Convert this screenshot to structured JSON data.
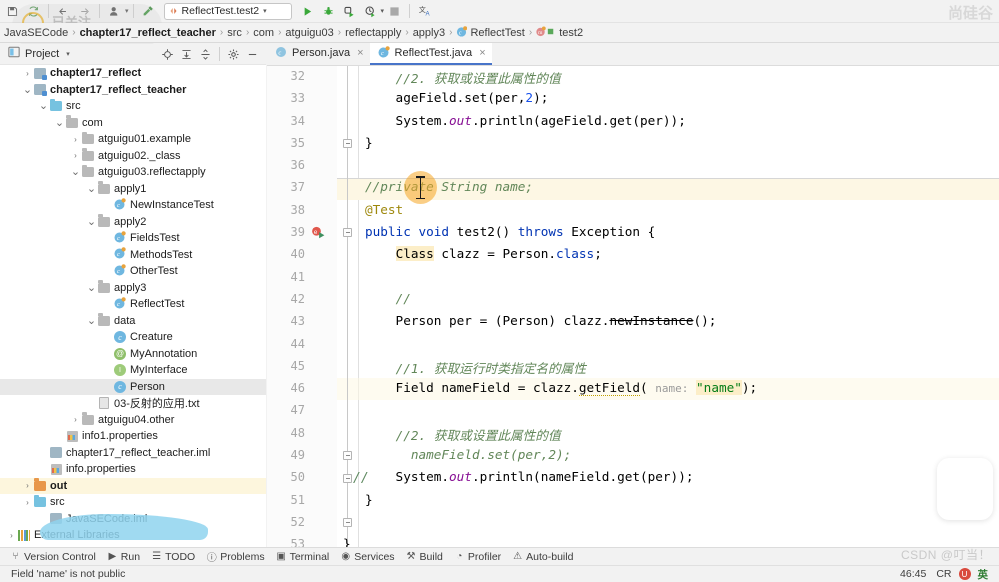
{
  "toolbar": {
    "icons": [
      "save-all-icon",
      "sync-icon",
      "back-arrow-icon",
      "forward-arrow-icon",
      "profile-icon",
      "build-hammer-icon"
    ],
    "run_config": {
      "label": "ReflectTest.test2"
    },
    "actions": [
      "run-icon",
      "debug-icon",
      "run-coverage-icon",
      "profile-run-icon",
      "stop-icon",
      "translate-icon"
    ]
  },
  "breadcrumb": {
    "items": [
      {
        "label": "JavaSECode",
        "bold": false
      },
      {
        "label": "chapter17_reflect_teacher",
        "bold": true
      },
      {
        "label": "src",
        "bold": false
      },
      {
        "label": "com",
        "bold": false
      },
      {
        "label": "atguigu03",
        "bold": false
      },
      {
        "label": "reflectapply",
        "bold": false
      },
      {
        "label": "apply3",
        "bold": false
      },
      {
        "label": "ReflectTest",
        "bold": false
      },
      {
        "label": "test2",
        "bold": false
      }
    ],
    "separator": "›"
  },
  "project_panel": {
    "title": "Project",
    "dropdown_caret": "▾",
    "header_icons": [
      "locate-icon",
      "expand-all-icon",
      "collapse-all-icon",
      "settings-gear-icon",
      "hide-icon"
    ],
    "tree": [
      {
        "label": "chapter17_reflect",
        "indent": 1,
        "twist": "›",
        "icon": "module-icon",
        "bold": true,
        "sel": ""
      },
      {
        "label": "chapter17_reflect_teacher",
        "indent": 1,
        "twist": "⌄",
        "icon": "module-icon",
        "bold": true,
        "sel": ""
      },
      {
        "label": "src",
        "indent": 2,
        "twist": "⌄",
        "icon": "folder-blue",
        "bold": false,
        "sel": ""
      },
      {
        "label": "com",
        "indent": 3,
        "twist": "⌄",
        "icon": "folder-pkg",
        "bold": false,
        "sel": ""
      },
      {
        "label": "atguigu01.example",
        "indent": 4,
        "twist": "›",
        "icon": "folder-pkg",
        "bold": false,
        "sel": ""
      },
      {
        "label": "atguigu02._class",
        "indent": 4,
        "twist": "›",
        "icon": "folder-pkg",
        "bold": false,
        "sel": ""
      },
      {
        "label": "atguigu03.reflectapply",
        "indent": 4,
        "twist": "⌄",
        "icon": "folder-pkg",
        "bold": false,
        "sel": ""
      },
      {
        "label": "apply1",
        "indent": 5,
        "twist": "⌄",
        "icon": "folder-pkg",
        "bold": false,
        "sel": ""
      },
      {
        "label": "NewInstanceTest",
        "indent": 6,
        "twist": "",
        "icon": "class-test",
        "bold": false,
        "sel": ""
      },
      {
        "label": "apply2",
        "indent": 5,
        "twist": "⌄",
        "icon": "folder-pkg",
        "bold": false,
        "sel": ""
      },
      {
        "label": "FieldsTest",
        "indent": 6,
        "twist": "",
        "icon": "class-test",
        "bold": false,
        "sel": ""
      },
      {
        "label": "MethodsTest",
        "indent": 6,
        "twist": "",
        "icon": "class-test",
        "bold": false,
        "sel": ""
      },
      {
        "label": "OtherTest",
        "indent": 6,
        "twist": "",
        "icon": "class-test",
        "bold": false,
        "sel": ""
      },
      {
        "label": "apply3",
        "indent": 5,
        "twist": "⌄",
        "icon": "folder-pkg",
        "bold": false,
        "sel": ""
      },
      {
        "label": "ReflectTest",
        "indent": 6,
        "twist": "",
        "icon": "class-test",
        "bold": false,
        "sel": ""
      },
      {
        "label": "data",
        "indent": 5,
        "twist": "⌄",
        "icon": "folder-pkg",
        "bold": false,
        "sel": ""
      },
      {
        "label": "Creature",
        "indent": 6,
        "twist": "",
        "icon": "class",
        "bold": false,
        "sel": ""
      },
      {
        "label": "MyAnnotation",
        "indent": 6,
        "twist": "",
        "icon": "annotation",
        "bold": false,
        "sel": ""
      },
      {
        "label": "MyInterface",
        "indent": 6,
        "twist": "",
        "icon": "interface",
        "bold": false,
        "sel": ""
      },
      {
        "label": "Person",
        "indent": 6,
        "twist": "",
        "icon": "class",
        "bold": false,
        "sel": "grey"
      },
      {
        "label": "03-反射的应用.txt",
        "indent": 5,
        "twist": "",
        "icon": "txt",
        "bold": false,
        "sel": ""
      },
      {
        "label": "atguigu04.other",
        "indent": 4,
        "twist": "›",
        "icon": "folder-pkg",
        "bold": false,
        "sel": ""
      },
      {
        "label": "info1.properties",
        "indent": 3,
        "twist": "",
        "icon": "properties",
        "bold": false,
        "sel": ""
      },
      {
        "label": "chapter17_reflect_teacher.iml",
        "indent": 2,
        "twist": "",
        "icon": "iml",
        "bold": false,
        "sel": ""
      },
      {
        "label": "info.properties",
        "indent": 2,
        "twist": "",
        "icon": "properties",
        "bold": false,
        "sel": ""
      },
      {
        "label": "out",
        "indent": 1,
        "twist": "›",
        "icon": "folder-orange",
        "bold": true,
        "sel": "yellow"
      },
      {
        "label": "src",
        "indent": 1,
        "twist": "›",
        "icon": "folder-blue",
        "bold": false,
        "sel": ""
      },
      {
        "label": "JavaSECode.iml",
        "indent": 2,
        "twist": "",
        "icon": "iml",
        "bold": false,
        "sel": ""
      },
      {
        "label": "External Libraries",
        "indent": 0,
        "twist": "›",
        "icon": "library",
        "bold": false,
        "sel": ""
      }
    ]
  },
  "editor_tabs": [
    {
      "label": "Person.java",
      "icon": "class-icon",
      "active": false,
      "close": "×"
    },
    {
      "label": "ReflectTest.java",
      "icon": "class-test-icon",
      "active": true,
      "close": "×"
    }
  ],
  "editor": {
    "lines": [
      {
        "n": 32,
        "html": "    <span class=\"cmt2\">//2. 获取或设置此属性的值</span>"
      },
      {
        "n": 33,
        "html": "    ageField.set(per,<span class=\"num\">2</span>);"
      },
      {
        "n": 34,
        "html": "    System.<span class=\"stat\">out</span>.println(ageField.get(per));"
      },
      {
        "n": 35,
        "html": "}"
      },
      {
        "n": 36,
        "html": ""
      },
      {
        "n": 37,
        "html": "<span class=\"cmt2\">//private String name;</span>"
      },
      {
        "n": 38,
        "html": "<span class=\"ann\">@Test</span>"
      },
      {
        "n": 39,
        "html": "<span class=\"kw\">public</span> <span class=\"kw\">void</span> test2() <span class=\"kw\">throws</span> Exception {"
      },
      {
        "n": 40,
        "html": "    <span class=\"boxhl\">Class</span> clazz = Person.<span class=\"kw\">class</span>;"
      },
      {
        "n": 41,
        "html": ""
      },
      {
        "n": 42,
        "html": "    <span class=\"cmt2\">//</span>"
      },
      {
        "n": 43,
        "html": "    Person per = (Person) clazz.<span class=\"depr\">newInstance</span>();"
      },
      {
        "n": 44,
        "html": ""
      },
      {
        "n": 45,
        "html": "    <span class=\"cmt2\">//1. 获取运行时类指定名的属性</span>"
      },
      {
        "n": 46,
        "html": "    Field nameField = clazz.<span class=\"warnu\">getField</span>( <span class=\"hint\">name:</span> <span class=\"str strhl\">\"name\"</span>);"
      },
      {
        "n": 47,
        "html": ""
      },
      {
        "n": 48,
        "html": "    <span class=\"cmt2\">//2. 获取或设置此属性的值</span>"
      },
      {
        "n": 49,
        "html": "      <span class=\"cmt2\">nameField.set(per,2);</span>"
      },
      {
        "n": 50,
        "html": "    System.<span class=\"stat\">out</span>.println(nameField.get(per));"
      },
      {
        "n": 51,
        "html": "}"
      },
      {
        "n": 52,
        "html": ""
      },
      {
        "n": 53,
        "html": "<span style=\"margin-left:-22px\">}</span>"
      }
    ],
    "gutter_comment_marker": "//"
  },
  "tool_window_bar": {
    "items": [
      {
        "label": "Version Control",
        "icon": "branch-icon"
      },
      {
        "label": "Run",
        "icon": "run-icon"
      },
      {
        "label": "TODO",
        "icon": "todo-icon"
      },
      {
        "label": "Problems",
        "icon": "problems-icon"
      },
      {
        "label": "Terminal",
        "icon": "terminal-icon"
      },
      {
        "label": "Services",
        "icon": "services-icon"
      },
      {
        "label": "Build",
        "icon": "build-hammer-icon"
      },
      {
        "label": "Profiler",
        "icon": "profiler-icon"
      },
      {
        "label": "Auto-build",
        "icon": "warning-icon"
      }
    ]
  },
  "status_bar": {
    "message": "Field 'name' is not public",
    "caret_position": "46:45",
    "line_separator": "CR",
    "ime_badge": "U",
    "ime_label": "英"
  },
  "watermarks": {
    "csdn": "CSDN @叮当！",
    "top_right": "尚硅谷",
    "follow_button": "已关注"
  },
  "colors": {
    "accent_blue": "#4874c9",
    "keyword": "#0033b3",
    "string": "#067d17",
    "comment": "#628759",
    "annotation": "#9e880d",
    "cursor_highlight": "#f5a623",
    "selection_grey": "#e8e8e8",
    "selection_yellow": "#fdf6dd"
  }
}
